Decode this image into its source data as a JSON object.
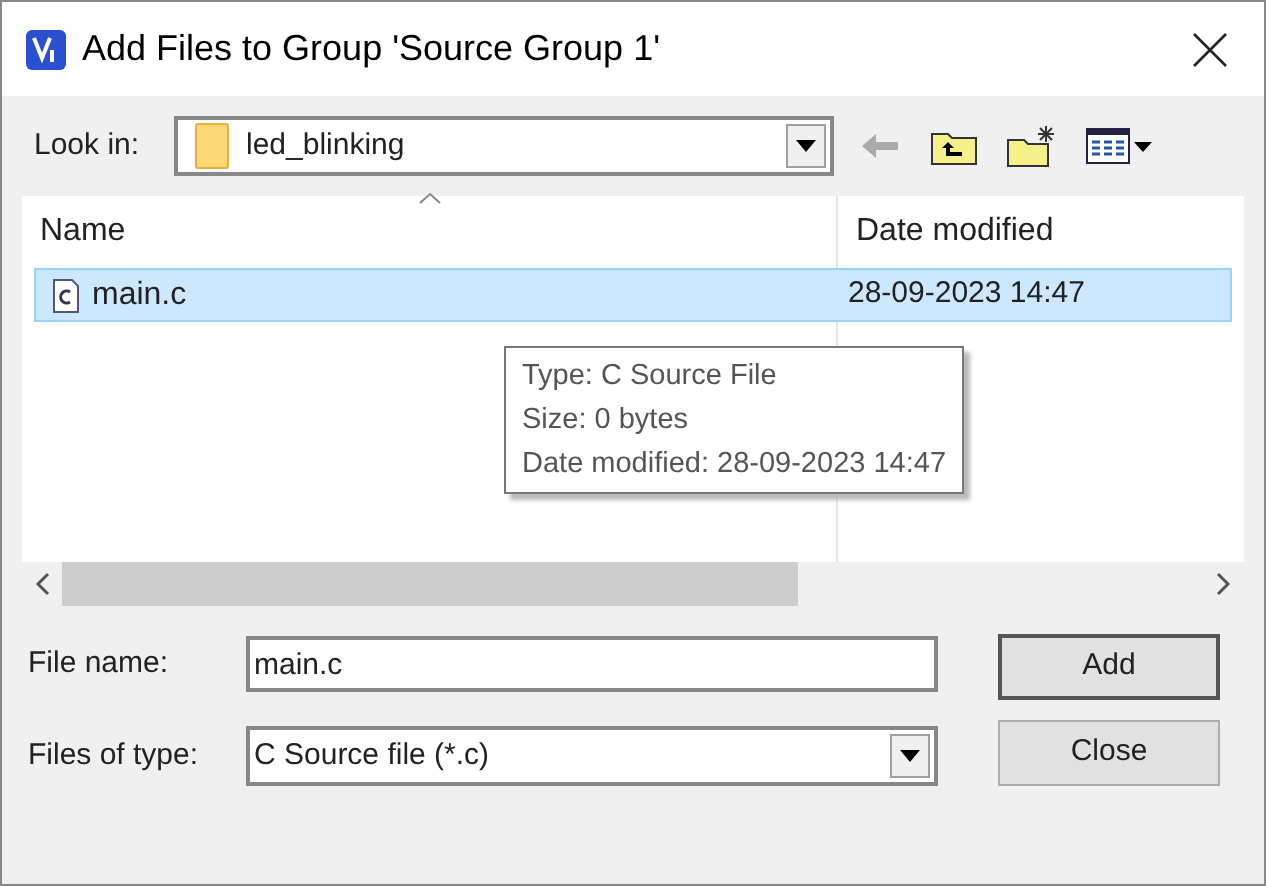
{
  "window": {
    "title": "Add Files to Group 'Source Group 1'"
  },
  "look_in": {
    "label": "Look in:",
    "value": "led_blinking"
  },
  "file_list": {
    "columns": [
      "Name",
      "Date modified"
    ],
    "rows": [
      {
        "name": "main.c",
        "date": "28-09-2023 14:47",
        "selected": true
      }
    ]
  },
  "tooltip": [
    "Type: C Source File",
    "Size: 0 bytes",
    "Date modified: 28-09-2023 14:47"
  ],
  "file_name": {
    "label": "File name:",
    "value": "main.c"
  },
  "files_of_type": {
    "label": "Files of type:",
    "value": "C Source file (*.c)"
  },
  "buttons": [
    "Add",
    "Close"
  ]
}
